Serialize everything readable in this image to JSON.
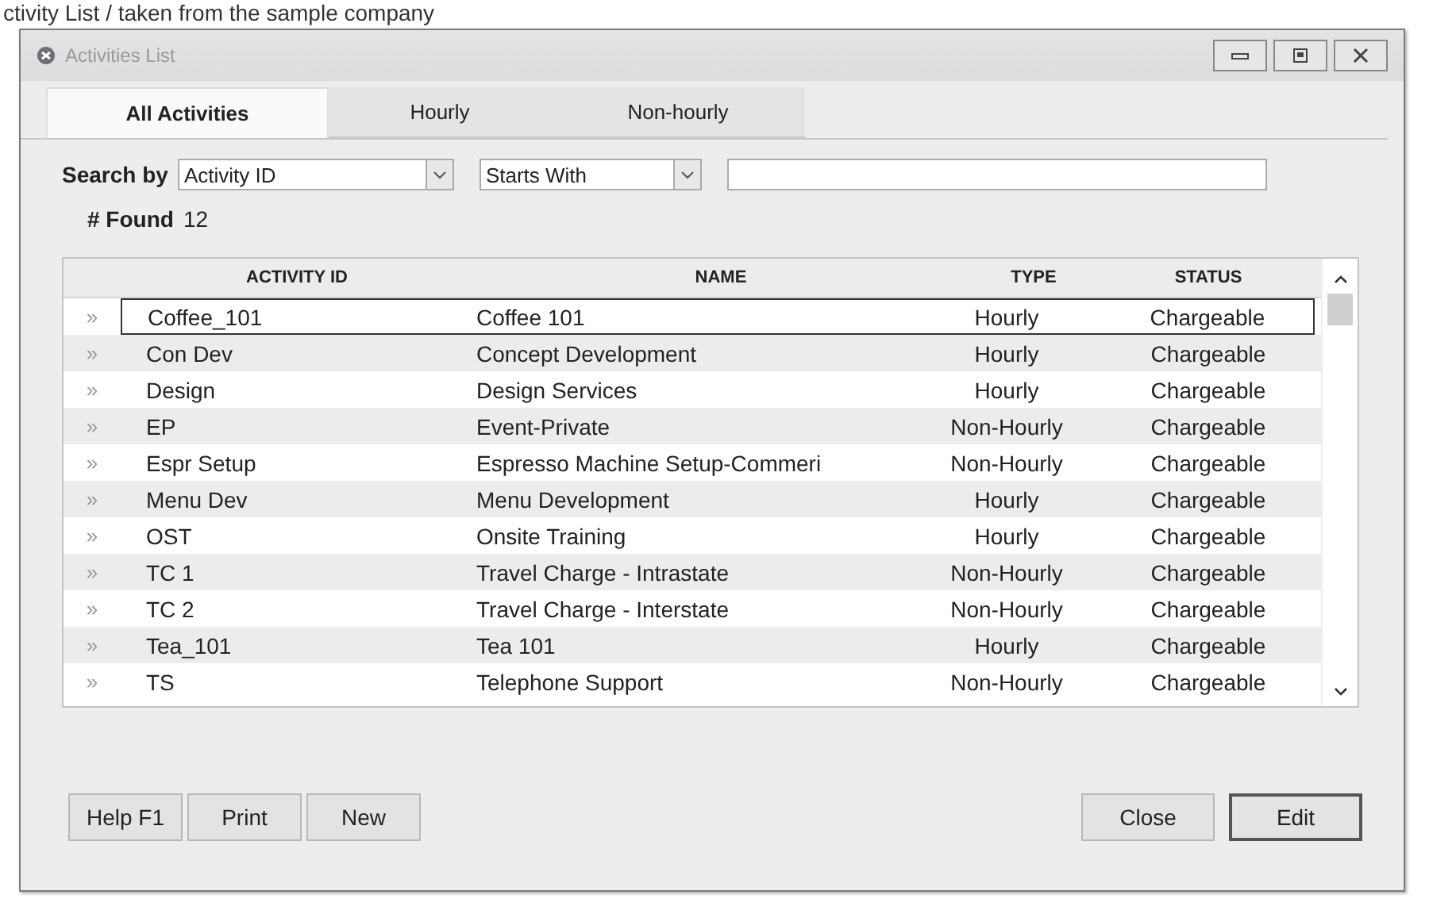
{
  "caption": "ctivity List / taken from the sample company",
  "window": {
    "title": "Activities List"
  },
  "tabs": [
    {
      "label": "All Activities",
      "selected": true
    },
    {
      "label": "Hourly",
      "selected": false
    },
    {
      "label": "Non-hourly",
      "selected": false
    }
  ],
  "search": {
    "label": "Search by",
    "field": "Activity ID",
    "mode": "Starts With",
    "found_label": "# Found",
    "found": "12"
  },
  "table": {
    "columns": [
      "ACTIVITY ID",
      "NAME",
      "TYPE",
      "STATUS"
    ],
    "rows": [
      {
        "cells": [
          "Coffee_101",
          "Coffee 101",
          "Hourly",
          "Chargeable"
        ],
        "selected": true
      },
      {
        "cells": [
          "Con Dev",
          "Concept Development",
          "Hourly",
          "Chargeable"
        ],
        "selected": false
      },
      {
        "cells": [
          "Design",
          "Design Services",
          "Hourly",
          "Chargeable"
        ],
        "selected": false
      },
      {
        "cells": [
          "EP",
          "Event-Private",
          "Non-Hourly",
          "Chargeable"
        ],
        "selected": false
      },
      {
        "cells": [
          "Espr Setup",
          "Espresso Machine Setup-Commeri",
          "Non-Hourly",
          "Chargeable"
        ],
        "selected": false
      },
      {
        "cells": [
          "Menu Dev",
          "Menu Development",
          "Hourly",
          "Chargeable"
        ],
        "selected": false
      },
      {
        "cells": [
          "OST",
          "Onsite Training",
          "Hourly",
          "Chargeable"
        ],
        "selected": false
      },
      {
        "cells": [
          "TC 1",
          "Travel Charge - Intrastate",
          "Non-Hourly",
          "Chargeable"
        ],
        "selected": false
      },
      {
        "cells": [
          "TC 2",
          "Travel Charge - Interstate",
          "Non-Hourly",
          "Chargeable"
        ],
        "selected": false
      },
      {
        "cells": [
          "Tea_101",
          "Tea 101",
          "Hourly",
          "Chargeable"
        ],
        "selected": false
      },
      {
        "cells": [
          "TS",
          "Telephone Support",
          "Non-Hourly",
          "Chargeable"
        ],
        "selected": false
      }
    ]
  },
  "row_marker": "»",
  "left_buttons": [
    "Help F1",
    "Print",
    "New"
  ],
  "right_buttons": [
    {
      "label": "Close",
      "default": false
    },
    {
      "label": "Edit",
      "default": true
    }
  ]
}
